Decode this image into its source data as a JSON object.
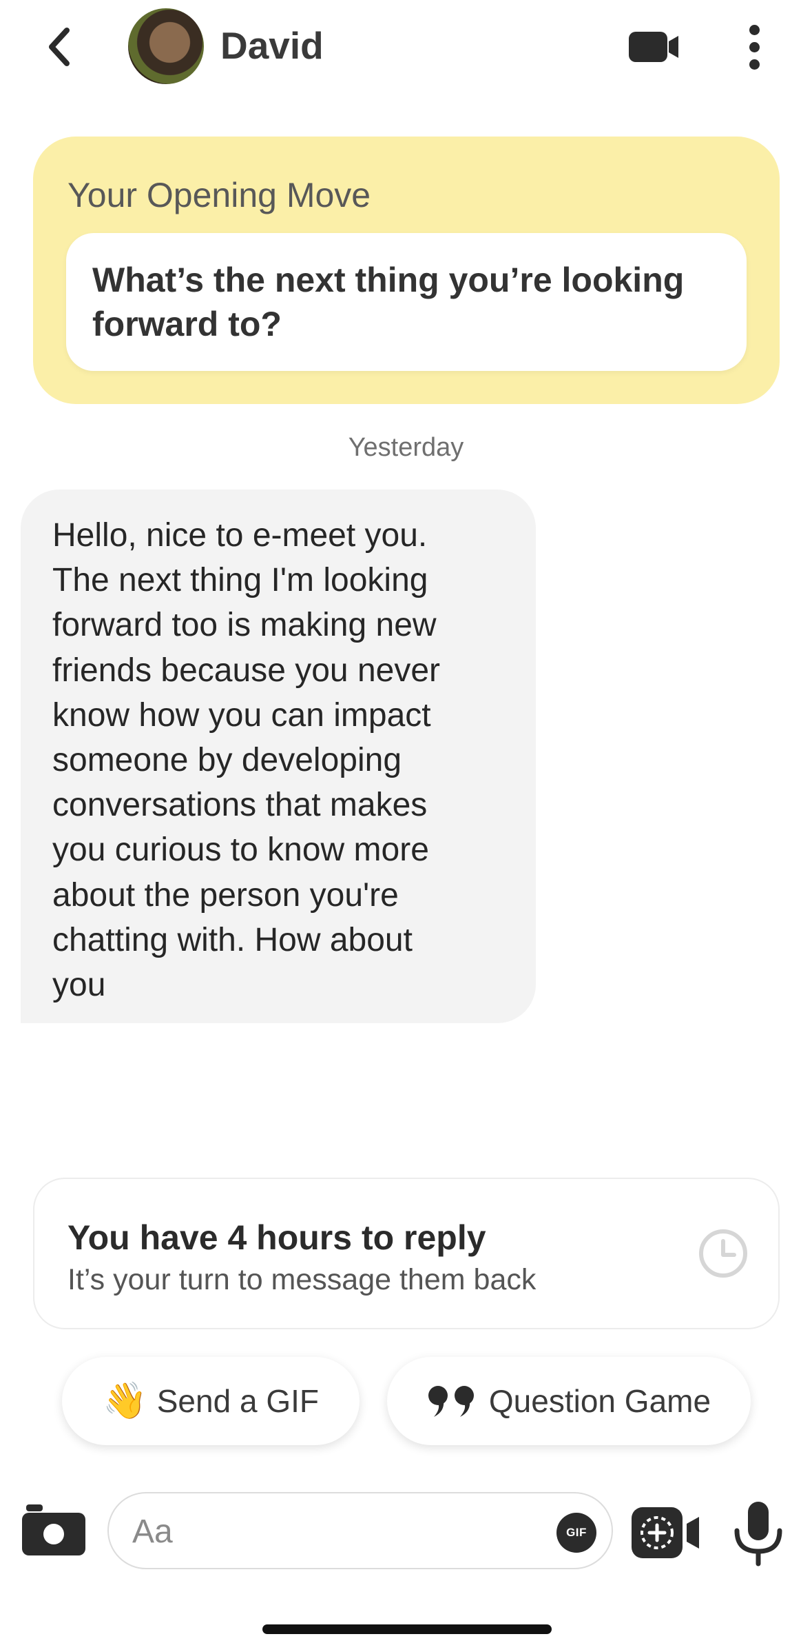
{
  "header": {
    "contact_name": "David",
    "back_icon": "chevron-left-icon",
    "video_icon": "video-camera-icon",
    "more_icon": "more-vertical-icon"
  },
  "opening_move": {
    "title": "Your Opening Move",
    "question": "What’s the next thing you’re looking forward to?"
  },
  "conversation": {
    "date_divider": "Yesterday",
    "messages": [
      {
        "sender": "David",
        "lines": [
          "Hello, nice to e-meet you.",
          "The next thing I'm looking",
          "forward too is making new",
          "friends because you never",
          "know how you can impact",
          "someone by developing",
          "conversations that makes",
          "you curious to know more",
          "about the person you're",
          "chatting with. How about",
          "you"
        ]
      }
    ]
  },
  "reply_timer": {
    "title": "You have 4 hours to reply",
    "subtitle": "It’s your turn to message them back",
    "icon": "clock-icon"
  },
  "suggestions": {
    "send_gif": {
      "emoji": "👋",
      "label": "Send a GIF"
    },
    "question_game": {
      "icon": "quote-icon",
      "label": "Question Game"
    }
  },
  "composer": {
    "placeholder": "Aa",
    "value": "",
    "gif_label": "GIF",
    "camera_icon": "camera-icon",
    "video_note_icon": "video-note-icon",
    "mic_icon": "microphone-icon"
  },
  "colors": {
    "opening_card_bg": "#fbefa8",
    "bubble_bg": "#f3f3f3",
    "icon_dark": "#2b2b2b"
  }
}
